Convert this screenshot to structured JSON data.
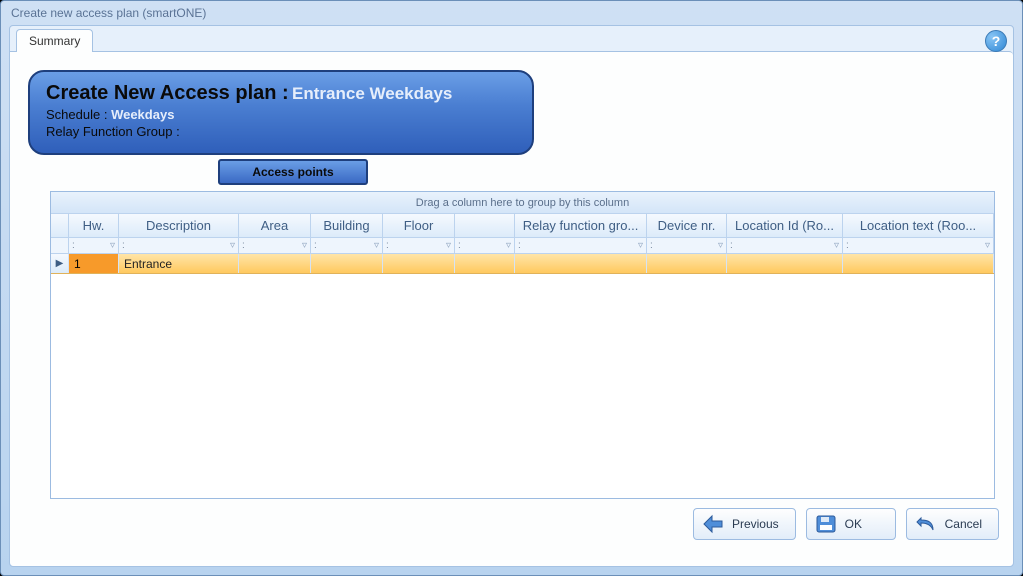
{
  "window": {
    "title": "Create new access plan (smartONE)"
  },
  "tabs": {
    "summary": "Summary"
  },
  "help": "?",
  "hero": {
    "title_prefix": "Create New Access plan :",
    "plan_name": "Entrance Weekdays",
    "schedule_label": "Schedule :",
    "schedule_value": "Weekdays",
    "relay_label": "Relay Function Group :",
    "relay_value": ""
  },
  "section_tab": "Access points",
  "grid": {
    "group_hint": "Drag a column here to group by this column",
    "headers": {
      "hw": "Hw.",
      "description": "Description",
      "area": "Area",
      "building": "Building",
      "floor": "Floor",
      "blank": "",
      "relay_function_group": "Relay function gro...",
      "device_nr": "Device nr.",
      "location_id": "Location Id (Ro...",
      "location_text": "Location text (Roo..."
    },
    "rows": [
      {
        "hw": "1",
        "description": "Entrance",
        "area": "",
        "building": "",
        "floor": "",
        "blank": "",
        "relay_function_group": "",
        "device_nr": "",
        "location_id": "",
        "location_text": ""
      }
    ]
  },
  "buttons": {
    "previous": "Previous",
    "ok": "OK",
    "cancel": "Cancel"
  }
}
